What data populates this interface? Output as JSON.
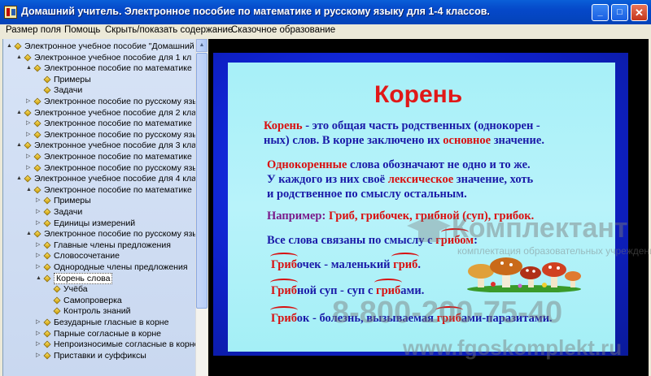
{
  "window": {
    "title": "Домашний учитель. Электронное пособие по математике и русскому языку для 1-4 классов.",
    "minimize_label": "_",
    "maximize_label": "□",
    "close_label": "✕"
  },
  "menu": {
    "items": [
      {
        "label": "Размер поля"
      },
      {
        "label": "Помощь"
      },
      {
        "label": "Скрыть/показать содержание"
      },
      {
        "label": "Сказочное образование"
      }
    ]
  },
  "tree": {
    "items": [
      {
        "label": "Электронное учебное пособие \"Домашний у",
        "level": 0,
        "toggle": "▲"
      },
      {
        "label": "Электронное учебное пособие для 1 кл",
        "level": 1,
        "toggle": "▲"
      },
      {
        "label": "Электронное пособие по математике",
        "level": 2,
        "toggle": "▲"
      },
      {
        "label": "Примеры",
        "level": 3,
        "toggle": ""
      },
      {
        "label": "Задачи",
        "level": 3,
        "toggle": ""
      },
      {
        "label": "Электронное пособие по русскому язы",
        "level": 2,
        "toggle": "▷"
      },
      {
        "label": "Электронное учебное пособие для 2 кла",
        "level": 1,
        "toggle": "▲"
      },
      {
        "label": "Электронное пособие по математике",
        "level": 2,
        "toggle": "▷"
      },
      {
        "label": "Электронное пособие по русскому язы",
        "level": 2,
        "toggle": "▷"
      },
      {
        "label": "Электронное учебное пособие для 3 кла",
        "level": 1,
        "toggle": "▲"
      },
      {
        "label": "Электронное пособие по математике",
        "level": 2,
        "toggle": "▷"
      },
      {
        "label": "Электронное пособие по русскому язы",
        "level": 2,
        "toggle": "▷"
      },
      {
        "label": "Электронное учебное пособие для 4 кла",
        "level": 1,
        "toggle": "▲"
      },
      {
        "label": "Электронное пособие по математике",
        "level": 2,
        "toggle": "▲"
      },
      {
        "label": "Примеры",
        "level": 3,
        "toggle": "▷"
      },
      {
        "label": "Задачи",
        "level": 3,
        "toggle": "▷"
      },
      {
        "label": "Единицы измерений",
        "level": 3,
        "toggle": "▷"
      },
      {
        "label": "Электронное пособие по русскому язы",
        "level": 2,
        "toggle": "▲"
      },
      {
        "label": "Главные члены предложения",
        "level": 3,
        "toggle": "▷"
      },
      {
        "label": "Словосочетание",
        "level": 3,
        "toggle": "▷"
      },
      {
        "label": "Однородные члены предложения",
        "level": 3,
        "toggle": "▷"
      },
      {
        "label": "Корень слова",
        "level": 3,
        "toggle": "▲",
        "selected": true
      },
      {
        "label": "Учёба",
        "level": 4,
        "toggle": ""
      },
      {
        "label": "Самопроверка",
        "level": 4,
        "toggle": ""
      },
      {
        "label": "Контроль знаний",
        "level": 4,
        "toggle": ""
      },
      {
        "label": "Безударные гласные в корне",
        "level": 3,
        "toggle": "▷"
      },
      {
        "label": "Парные согласные в корне",
        "level": 3,
        "toggle": "▷"
      },
      {
        "label": "Непроизносимые согласные в корне",
        "level": 3,
        "toggle": "▷"
      },
      {
        "label": "Приставки и суффиксы",
        "level": 3,
        "toggle": "▷"
      }
    ]
  },
  "slide": {
    "title": "Корень",
    "def_word": "Корень",
    "def_rest1": " - это общая часть родственных (однокорен -",
    "def_line2_a": "ных) слов. В корне заключено их ",
    "def_line2_b": "основное",
    "def_line2_c": " значение.",
    "p2_a": "Однокоренные",
    "p2_b": " слова обозначают не одно и то же.",
    "p2_line2_a": "У каждого из них своё ",
    "p2_line2_b": "лексическое",
    "p2_line2_c": " значение, хоть",
    "p2_line3": "и родственное по смыслу остальным.",
    "ex_label": "Например: ",
    "ex_words": "Гриб, грибочек, грибной (суп), грибок.",
    "link_a": "Все слова связаны по смыслу с ",
    "link_b": "грибом",
    "link_c": ":",
    "e1_root": "Гриб",
    "e1_rest": "очек - маленький ",
    "e1_root2": "гриб",
    "e1_end": ".",
    "e2_root": "Гриб",
    "e2_rest": "ной суп - суп с ",
    "e2_root2": "гриб",
    "e2_end": "ами.",
    "e3_root": "Гриб",
    "e3_rest": "ок - болезнь, вызываемая ",
    "e3_root2": "гриб",
    "e3_end": "ами-паразитами."
  },
  "watermark": {
    "brand": "Комплектант",
    "tagline": "комплектация образовательных учреждений",
    "phone": "8-800-200-75-40",
    "site": "www.fgoskomplekt.ru"
  }
}
